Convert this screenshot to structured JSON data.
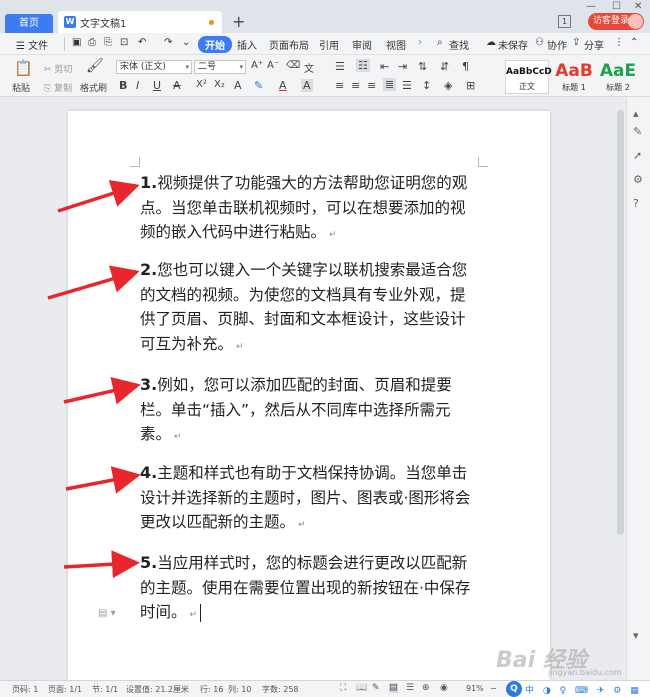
{
  "titlebar": {
    "home_tab": "首页",
    "doc_tab": "文字文稿1",
    "window_count": "1",
    "login": "访客登录"
  },
  "menu": {
    "file": "☰ 文件",
    "start": "开始",
    "insert": "插入",
    "layout": "页面布局",
    "reference": "引用",
    "review": "审阅",
    "view": "视图",
    "search": "查找",
    "unsaved": "未保存",
    "collab": "协作",
    "share": "分享"
  },
  "ribbon": {
    "paste": "粘贴",
    "cut": "剪切",
    "copy": "复制",
    "format_painter": "格式刷",
    "font_name": "宋体 (正文)",
    "font_size": "二号",
    "styles": [
      {
        "sample": "AaBbCcD",
        "caption": "正文"
      },
      {
        "sample": "AaB",
        "caption": "标题 1"
      },
      {
        "sample": "AaE",
        "caption": "标题 2"
      }
    ]
  },
  "document": {
    "paragraphs": [
      {
        "num": "1.",
        "text": "视频提供了功能强大的方法帮助您证明您的观点。当您单击联机视频时，可以在想要添加的视频的嵌入代码中进行粘贴。"
      },
      {
        "num": "2.",
        "text": "您也可以键入一个关键字以联机搜索最适合您的文档的视频。为使您的文档具有专业外观，提供了页眉、页脚、封面和文本框设计，这些设计可互为补充。"
      },
      {
        "num": "3.",
        "text": "例如，您可以添加匹配的封面、页眉和提要栏。单击“插入”，然后从不同库中选择所需元素。"
      },
      {
        "num": "4.",
        "text": "主题和样式也有助于文档保持协调。当您单击设计并选择新的主题时，图片、图表或·图形将会更改以匹配新的主题。"
      },
      {
        "num": "5.",
        "text": "当应用样式时，您的标题会进行更改以匹配新的主题。使用在需要位置出现的新按钮在·中保存时间。"
      }
    ],
    "pmark": "↵"
  },
  "status": {
    "page_num": "页码: 1",
    "pages": "页面: 1/1",
    "section": "节: 1/1",
    "set_value": "设置值: 21.2厘米",
    "row": "行: 16",
    "col": "列: 10",
    "words": "字数: 258",
    "zoom": "91%"
  },
  "ime": {
    "label": "中"
  },
  "watermark": {
    "main": "Bai 经验",
    "sub": "jingyan.baidu.com"
  },
  "colors": {
    "accent": "#3d7cf0",
    "arrow": "#e8262b",
    "login": "#e8483a"
  }
}
